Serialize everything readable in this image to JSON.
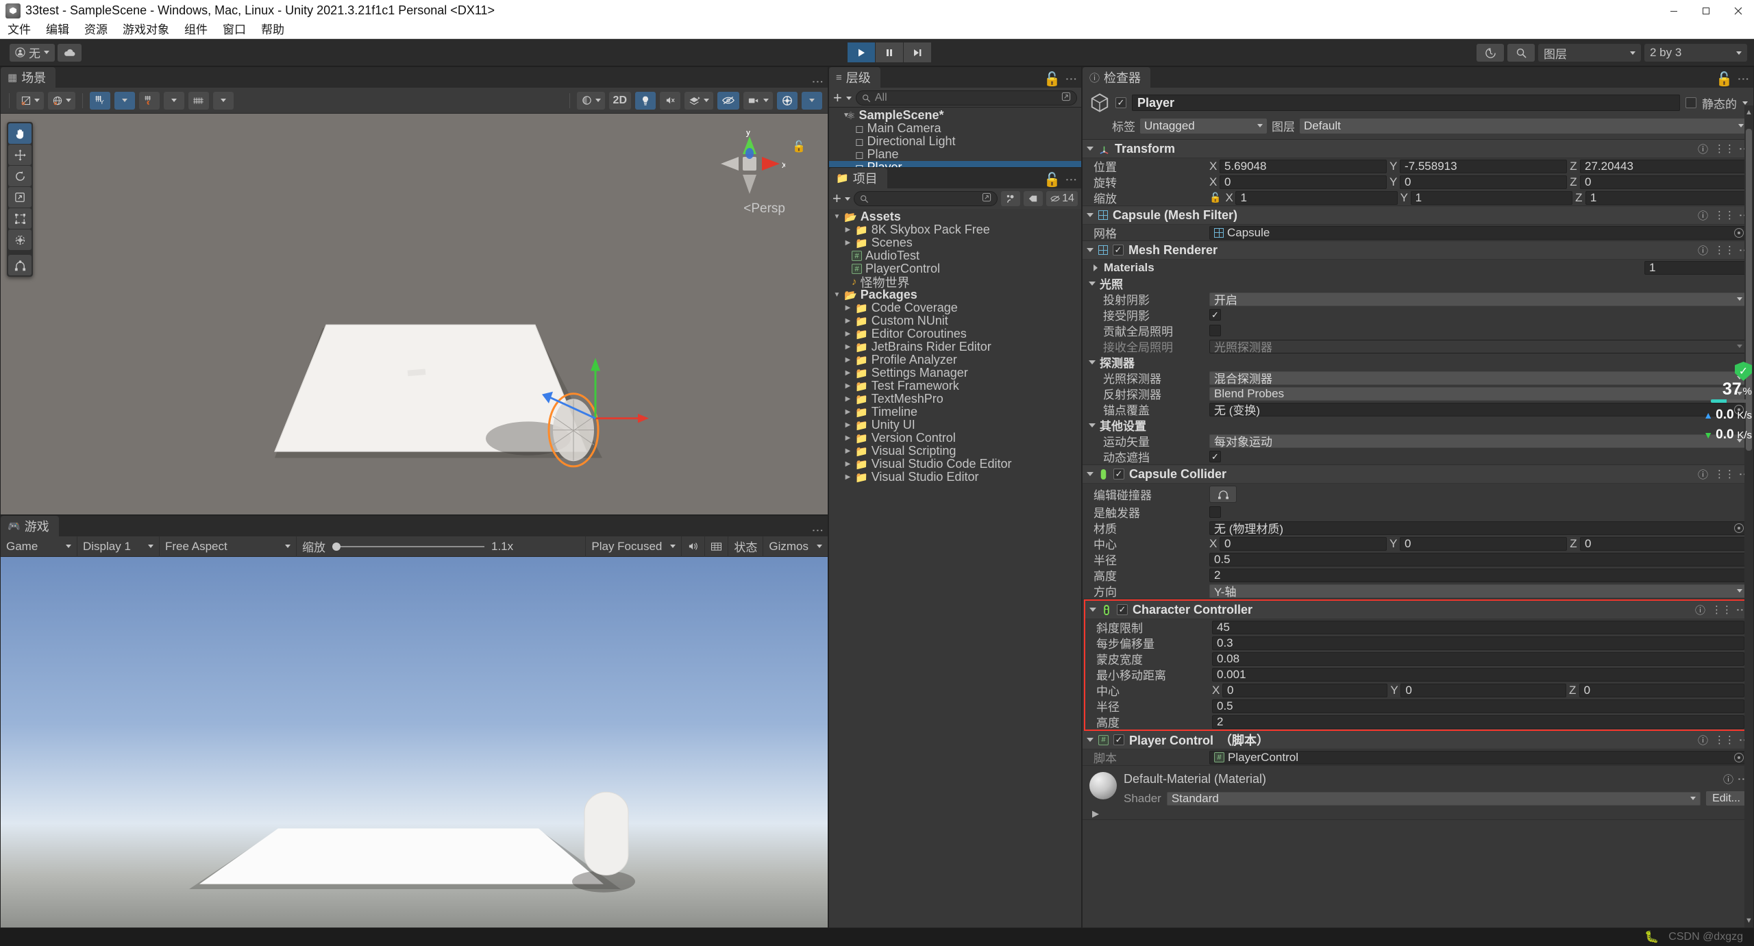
{
  "window": {
    "title": "33test - SampleScene - Windows, Mac, Linux - Unity 2021.3.21f1c1 Personal <DX11>",
    "minimize": "–",
    "maximize": "□",
    "close": "✕"
  },
  "menubar": {
    "items": [
      "文件",
      "编辑",
      "资源",
      "游戏对象",
      "组件",
      "窗口",
      "帮助"
    ]
  },
  "toolbar": {
    "account_label": "无",
    "account_icon": "person-icon",
    "cloud_icon": "cloud-icon",
    "play_icon": "play-icon",
    "pause_icon": "pause-icon",
    "step_icon": "step-icon",
    "history_icon": "history-icon",
    "search_icon": "search-icon",
    "layers_label": "图层",
    "layout_label": "2 by 3"
  },
  "scene": {
    "tab_label": "场景",
    "tab_icon": "scene-grid-icon",
    "tools": [
      "hand-tool",
      "move-tool",
      "rotate-tool",
      "scale-tool",
      "rect-tool",
      "transform-tool",
      "custom-tool"
    ],
    "toolbar_icons": [
      "pivot-icon",
      "global-icon",
      "grid-snap-icon",
      "magnet-snap-icon",
      "grid-visibility-icon"
    ],
    "right_icons": [
      "shading-icon",
      "2d-toggle",
      "lighting-icon",
      "audio-icon",
      "fx-icon",
      "hidden-icon",
      "camera-icon",
      "gizmos-icon"
    ],
    "toggle_2d": "2D",
    "persp_label": "Persp",
    "axis_y": "y",
    "axis_x": "x",
    "kebab": "⋮"
  },
  "game": {
    "tab_label": "游戏",
    "tab_icon": "gamepad-icon",
    "target_display": "Game",
    "display": "Display 1",
    "aspect": "Free Aspect",
    "scale_label": "缩放",
    "scale_value": "1.1x",
    "play_focused": "Play Focused",
    "mute_icon": "speaker-icon",
    "stats_icon": "stats-grid-icon",
    "stats_label": "状态",
    "gizmos_label": "Gizmos"
  },
  "hierarchy": {
    "tab_label": "层级",
    "tab_icon": "hierarchy-icon",
    "add_label": "+",
    "search_placeholder": "All",
    "lock_icon": "lock-icon",
    "kebab": "⋮",
    "items": [
      {
        "label": "SampleScene*",
        "depth": 0,
        "type": "scene",
        "expandable": true,
        "selected": false
      },
      {
        "label": "Main Camera",
        "depth": 1,
        "type": "gameobject",
        "selected": false
      },
      {
        "label": "Directional Light",
        "depth": 1,
        "type": "gameobject",
        "selected": false
      },
      {
        "label": "Plane",
        "depth": 1,
        "type": "gameobject",
        "selected": false
      },
      {
        "label": "Player",
        "depth": 1,
        "type": "gameobject",
        "selected": true
      }
    ]
  },
  "project": {
    "tab_label": "项目",
    "tab_icon": "folder-icon",
    "add_label": "+",
    "search_placeholder": "",
    "hidden_count": "14",
    "lock_icon": "lock-icon",
    "kebab": "⋮",
    "items": [
      {
        "label": "Assets",
        "depth": 0,
        "type": "root-folder",
        "expanded": true
      },
      {
        "label": "8K Skybox Pack Free",
        "depth": 1,
        "type": "folder",
        "expanded": false
      },
      {
        "label": "Scenes",
        "depth": 1,
        "type": "folder",
        "expanded": false
      },
      {
        "label": "AudioTest",
        "depth": 1,
        "type": "script"
      },
      {
        "label": "PlayerControl",
        "depth": 1,
        "type": "script"
      },
      {
        "label": "怪物世界",
        "depth": 1,
        "type": "audio"
      },
      {
        "label": "Packages",
        "depth": 0,
        "type": "root-folder",
        "expanded": true
      },
      {
        "label": "Code Coverage",
        "depth": 1,
        "type": "folder"
      },
      {
        "label": "Custom NUnit",
        "depth": 1,
        "type": "folder"
      },
      {
        "label": "Editor Coroutines",
        "depth": 1,
        "type": "folder"
      },
      {
        "label": "JetBrains Rider Editor",
        "depth": 1,
        "type": "folder"
      },
      {
        "label": "Profile Analyzer",
        "depth": 1,
        "type": "folder"
      },
      {
        "label": "Settings Manager",
        "depth": 1,
        "type": "folder"
      },
      {
        "label": "Test Framework",
        "depth": 1,
        "type": "folder"
      },
      {
        "label": "TextMeshPro",
        "depth": 1,
        "type": "folder"
      },
      {
        "label": "Timeline",
        "depth": 1,
        "type": "folder"
      },
      {
        "label": "Unity UI",
        "depth": 1,
        "type": "folder"
      },
      {
        "label": "Version Control",
        "depth": 1,
        "type": "folder"
      },
      {
        "label": "Visual Scripting",
        "depth": 1,
        "type": "folder"
      },
      {
        "label": "Visual Studio Code Editor",
        "depth": 1,
        "type": "folder"
      },
      {
        "label": "Visual Studio Editor",
        "depth": 1,
        "type": "folder"
      }
    ]
  },
  "inspector": {
    "tab_label": "检查器",
    "tab_icon": "info-icon",
    "lock_icon": "lock-icon",
    "kebab": "⋮",
    "object_name": "Player",
    "object_enabled": true,
    "static_label": "静态的",
    "tag_label": "标签",
    "tag_value": "Untagged",
    "layer_label": "图层",
    "layer_value": "Default",
    "transform": {
      "title": "Transform",
      "position_label": "位置",
      "rotation_label": "旋转",
      "scale_label": "缩放",
      "position": {
        "x": "5.69048",
        "y": "-7.558913",
        "z": "27.20443"
      },
      "rotation": {
        "x": "0",
        "y": "0",
        "z": "0"
      },
      "scale": {
        "x": "1",
        "y": "1",
        "z": "1"
      }
    },
    "mesh_filter": {
      "title": "Capsule (Mesh Filter)",
      "mesh_label": "网格",
      "mesh_value": "Capsule"
    },
    "mesh_renderer": {
      "title": "Mesh Renderer",
      "enabled": true,
      "materials_label": "Materials",
      "materials_count": "1",
      "lighting_label": "光照",
      "cast_shadows_label": "投射阴影",
      "cast_shadows_value": "开启",
      "receive_shadows_label": "接受阴影",
      "receive_shadows_value": true,
      "contribute_gi_label": "贡献全局照明",
      "contribute_gi_value": false,
      "receive_gi_label": "接收全局照明",
      "receive_gi_value": "光照探测器",
      "probes_label": "探测器",
      "light_probes_label": "光照探测器",
      "light_probes_value": "混合探测器",
      "reflection_probes_label": "反射探测器",
      "reflection_probes_value": "Blend Probes",
      "anchor_override_label": "锚点覆盖",
      "anchor_override_value": "无 (变换)",
      "additional_label": "其他设置",
      "motion_vectors_label": "运动矢量",
      "motion_vectors_value": "每对象运动",
      "dynamic_occlusion_label": "动态遮挡",
      "dynamic_occlusion_value": true
    },
    "capsule_collider": {
      "title": "Capsule Collider",
      "enabled": true,
      "edit_collider_label": "编辑碰撞器",
      "is_trigger_label": "是触发器",
      "is_trigger_value": false,
      "material_label": "材质",
      "material_value": "无 (物理材质)",
      "center_label": "中心",
      "center": {
        "x": "0",
        "y": "0",
        "z": "0"
      },
      "radius_label": "半径",
      "radius_value": "0.5",
      "height_label": "高度",
      "height_value": "2",
      "direction_label": "方向",
      "direction_value": "Y-轴"
    },
    "character_controller": {
      "title": "Character Controller",
      "enabled": true,
      "highlighted": true,
      "slope_limit_label": "斜度限制",
      "slope_limit_value": "45",
      "step_offset_label": "每步偏移量",
      "step_offset_value": "0.3",
      "skin_width_label": "蒙皮宽度",
      "skin_width_value": "0.08",
      "min_move_label": "最小移动距离",
      "min_move_value": "0.001",
      "center_label": "中心",
      "center": {
        "x": "0",
        "y": "0",
        "z": "0"
      },
      "radius_label": "半径",
      "radius_value": "0.5",
      "height_label": "高度",
      "height_value": "2"
    },
    "player_control": {
      "title": "Player Control　（脚本）",
      "enabled": true,
      "script_label": "脚本",
      "script_value": "PlayerControl"
    },
    "material_preview": {
      "title": "Default-Material (Material)",
      "shader_label": "Shader",
      "shader_value": "Standard",
      "edit_label": "Edit..."
    }
  },
  "network_overlay": {
    "percent": "37",
    "percent_unit": "%",
    "upload_value": "0.0",
    "upload_unit": "K/s",
    "download_value": "0.0",
    "download_unit": "K/s"
  },
  "statusbar": {
    "bug_icon": "bug-icon",
    "watermark": "CSDN @dxgzg"
  },
  "colors": {
    "accent": "#2c5d87",
    "highlight_red": "#f4372d",
    "panel_bg": "#383838",
    "header_bg": "#3f3f3f"
  }
}
